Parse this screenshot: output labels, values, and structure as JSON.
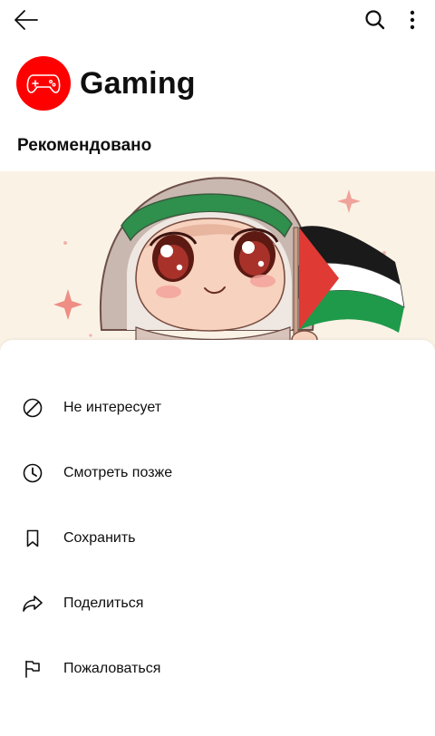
{
  "channel": {
    "name": "Gaming",
    "avatar_color": "#ff0000",
    "avatar_icon": "gamepad-icon"
  },
  "section": {
    "title": "Рекомендовано"
  },
  "topbar": {
    "back_icon": "arrow-left-icon",
    "search_icon": "search-icon",
    "more_icon": "more-vertical-icon"
  },
  "menu": {
    "items": [
      {
        "label": "Не интересует",
        "icon": "not-interested-icon"
      },
      {
        "label": "Смотреть позже",
        "icon": "clock-icon"
      },
      {
        "label": "Сохранить",
        "icon": "bookmark-icon"
      },
      {
        "label": "Поделиться",
        "icon": "share-icon"
      },
      {
        "label": "Пожаловаться",
        "icon": "flag-icon"
      }
    ]
  }
}
